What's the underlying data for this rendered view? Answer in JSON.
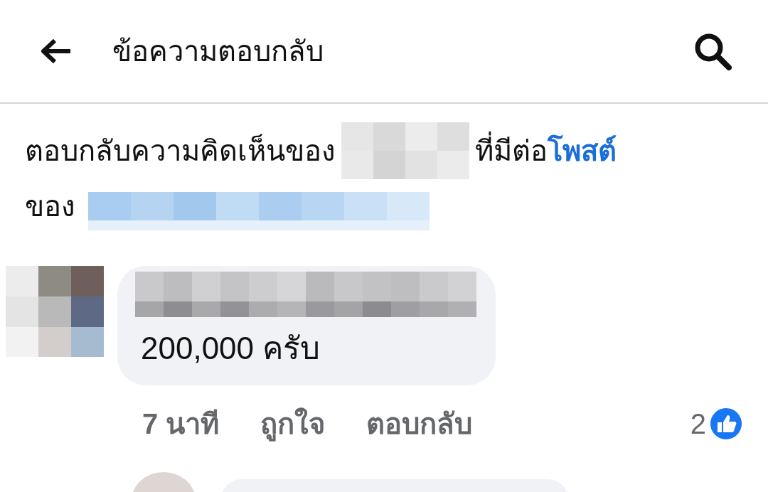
{
  "header": {
    "title": "ข้อความตอบกลับ"
  },
  "context": {
    "lines": [
      [
        {
          "kind": "text",
          "text": "ตอบกลับความคิดเห็นของ"
        },
        {
          "kind": "redacted"
        },
        {
          "kind": "text",
          "text": "ที่มีต่อ"
        },
        {
          "kind": "link",
          "text": "โพสต์"
        }
      ],
      [
        {
          "kind": "text",
          "text": "ของ"
        },
        {
          "kind": "redacted_link"
        }
      ]
    ]
  },
  "comment": {
    "text": "200,000 ครับ",
    "time": "7 นาที",
    "actions": [
      "ถูกใจ",
      "ตอบกลับ"
    ],
    "like_count": "2"
  }
}
